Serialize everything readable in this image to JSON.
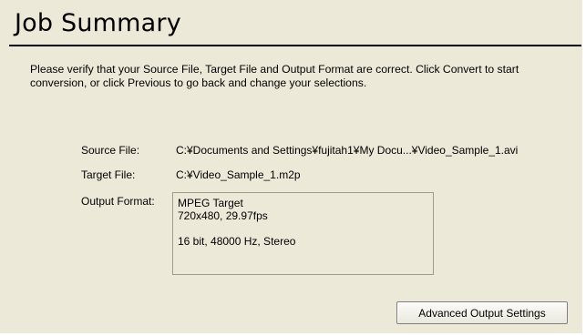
{
  "page": {
    "title": "Job Summary",
    "instructions": "Please verify that your Source File, Target File and Output Format are correct. Click Convert to start conversion, or click Previous to go back and change your selections."
  },
  "fields": {
    "source_label": "Source File:",
    "source_value": "C:¥Documents and Settings¥fujitah1¥My Docu...¥Video_Sample_1.avi",
    "target_label": "Target File:",
    "target_value": "C:¥Video_Sample_1.m2p",
    "output_label": "Output Format:",
    "output_lines": [
      "MPEG Target",
      "720x480, 29.97fps",
      "16 bit, 48000 Hz, Stereo"
    ]
  },
  "buttons": {
    "advanced_label": "Advanced Output Settings"
  },
  "colors": {
    "panel_background": "#ece9d8",
    "border_gray": "#9d9d8a"
  }
}
